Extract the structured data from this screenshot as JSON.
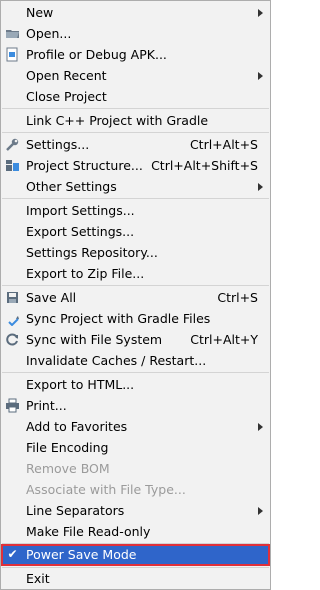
{
  "menu": {
    "new": "New",
    "open": "Open...",
    "profile_debug_apk": "Profile or Debug APK...",
    "open_recent": "Open Recent",
    "close_project": "Close Project",
    "link_cpp": "Link C++ Project with Gradle",
    "settings": "Settings...",
    "settings_shortcut": "Ctrl+Alt+S",
    "project_structure": "Project Structure...",
    "project_structure_shortcut": "Ctrl+Alt+Shift+S",
    "other_settings": "Other Settings",
    "import_settings": "Import Settings...",
    "export_settings": "Export Settings...",
    "settings_repository": "Settings Repository...",
    "export_zip": "Export to Zip File...",
    "save_all": "Save All",
    "save_all_shortcut": "Ctrl+S",
    "sync_gradle": "Sync Project with Gradle Files",
    "sync_fs": "Sync with File System",
    "sync_fs_shortcut": "Ctrl+Alt+Y",
    "invalidate_caches": "Invalidate Caches / Restart...",
    "export_html": "Export to HTML...",
    "print": "Print...",
    "add_favorites": "Add to Favorites",
    "file_encoding": "File Encoding",
    "remove_bom": "Remove BOM",
    "associate_file_type": "Associate with File Type...",
    "line_separators": "Line Separators",
    "make_readonly": "Make File Read-only",
    "power_save_mode": "Power Save Mode",
    "exit": "Exit"
  },
  "icons": {
    "open": "folder-icon",
    "profile": "apk-profile-icon",
    "settings": "wrench-icon",
    "project_structure": "project-structure-icon",
    "save_all": "save-icon",
    "sync_gradle": "gradle-sync-icon",
    "sync_fs": "refresh-icon",
    "print": "printer-icon",
    "power_save": "checkmark-icon"
  },
  "colors": {
    "menu_bg": "#f2f2f2",
    "selected_bg": "#2f65ca",
    "highlight_border": "#e0303a",
    "disabled_text": "#9b9b9b"
  }
}
